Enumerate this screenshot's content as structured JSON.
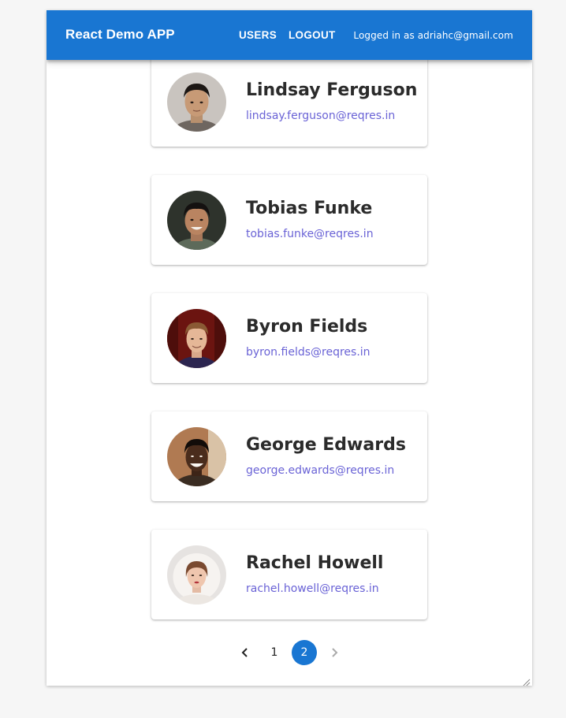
{
  "appbar": {
    "brand": "React Demo APP",
    "nav": {
      "users": "USERS",
      "logout": "LOGOUT"
    },
    "logged_in_text": "Logged in as adriahc@gmail.com"
  },
  "users": [
    {
      "name": "Lindsay Ferguson",
      "email": "lindsay.ferguson@reqres.in"
    },
    {
      "name": "Tobias Funke",
      "email": "tobias.funke@reqres.in"
    },
    {
      "name": "Byron Fields",
      "email": "byron.fields@reqres.in"
    },
    {
      "name": "George Edwards",
      "email": "george.edwards@reqres.in"
    },
    {
      "name": "Rachel Howell",
      "email": "rachel.howell@reqres.in"
    }
  ],
  "pagination": {
    "prev_icon": "chevron-left-icon",
    "pages": [
      "1",
      "2"
    ],
    "current": "2",
    "next_icon": "chevron-right-icon"
  },
  "colors": {
    "primary": "#1976d2",
    "email": "#6a63d6"
  }
}
